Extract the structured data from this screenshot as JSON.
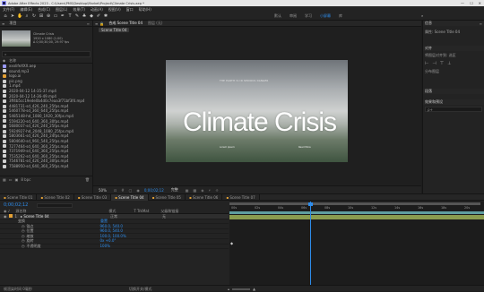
{
  "app": {
    "title": "Adobe After Effects 2023 - C:\\Users\\PMS\\Desktop\\Market\\Project\\Climate Crisis.aep *"
  },
  "menu": [
    "文件(F)",
    "编辑(E)",
    "合成(C)",
    "图层(L)",
    "效果(T)",
    "动画(A)",
    "视图(V)",
    "窗口",
    "帮助(H)"
  ],
  "workspaces": [
    "默认",
    "审阅",
    "学习",
    "小屏幕",
    "库"
  ],
  "project_panel": {
    "tab": "项目",
    "comp_name": "Climate Crisis",
    "comp_info_1": "1920 x 1080 (1.00)",
    "comp_info_2": "Δ 0;00;30;00, 29.97 fps",
    "search_placeholder": "",
    "col_name": "名称",
    "items": [
      "xxxlifeXXX.aep",
      "sound.mp3",
      "logo.ai",
      "pic.png",
      "1.mp4",
      "2020-04-12 14-35-37.mp4",
      "2020-04-12 14-36-49.mp4",
      "3ff4b5cc19ede0b4d0c7eaa3f71bf3f4.mp4",
      "4481731-sd_426_240_25fps.mp4",
      "5460778-sd_360_640_25fps.mp4",
      "5485148-hd_1080_1920_30fps.mp4",
      "5594220-sd_640_360_30fps.mp4",
      "5680037-sd_426_240_25fps.mp4",
      "5924927-hd_2048_1080_25fps.mp4",
      "5803661-sd_426_240_24fps.mp4",
      "5804640-sd_960_540_25fps.mp4",
      "7277464-sd_640_360_25fps.mp4",
      "7371949-sd_640_360_25fps.mp4",
      "7535262-sd_640_360_25fps.mp4",
      "7546781-sd_426_240_30fps.mp4",
      "7588950-sd_640_360_25fps.mp4"
    ],
    "footer_bpc": "8 bpc"
  },
  "comp_panel": {
    "tab": "合成 Scene Title 04",
    "layer_tab": "图层 (无)",
    "breadcrumb": "Scene Title 04",
    "video_title": "Climate Crisis",
    "video_subtitle": "THE EARTH IS IN SERIOUS DANGER",
    "video_caption_1": "Lorem ipsum",
    "video_caption_2": "Read More",
    "zoom": "50%",
    "quality": "完整",
    "timecode": "0;00;02;12"
  },
  "right_panel": {
    "panel1_title": "信息",
    "panel1_sub": "属性: Scene Title 04",
    "panel2_title": "对齐",
    "panel2_line1": "将图层对齐到: 选区",
    "panel2_line2": "分布图层",
    "panel3_title": "段落",
    "panel4_title": "效果和预设",
    "search_placeholder": "ρ+"
  },
  "timeline": {
    "tabs": [
      "Scene Title 01",
      "Scene Title 02",
      "Scene Title 03",
      "Scene Title 04",
      "Scene Title 05",
      "Scene Title 06",
      "Scene Title 07"
    ],
    "active_tab_index": 3,
    "timecode": "0;00;02;12",
    "col_source": "源名称",
    "col_mode": "模式",
    "col_trkmat": "T TrkMat",
    "col_parent": "父级和链接",
    "layers": [
      {
        "num": "1",
        "name": "▸ Scene Title 04",
        "mode": "正常",
        "parent": "无"
      },
      {
        "num": "",
        "name": "变换",
        "mode": "重置",
        "parent": ""
      },
      {
        "num": "",
        "name": "锚点",
        "mode": "960.0, 540.0",
        "parent": ""
      },
      {
        "num": "",
        "name": "位置",
        "mode": "960.0, 540.0",
        "parent": ""
      },
      {
        "num": "",
        "name": "缩放",
        "mode": "100.0, 100.0%",
        "parent": ""
      },
      {
        "num": "",
        "name": "旋转",
        "mode": "0x +0.0°",
        "parent": ""
      },
      {
        "num": "",
        "name": "不透明度",
        "mode": "100%",
        "parent": ""
      }
    ],
    "ruler": [
      "00s",
      "02s",
      "04s",
      "06s",
      "08s",
      "10s",
      "12s",
      "14s",
      "16s",
      "18s",
      "20s"
    ],
    "footer_left": "帧渲染时间 0毫秒",
    "footer_mid": "切换开关/模式"
  }
}
